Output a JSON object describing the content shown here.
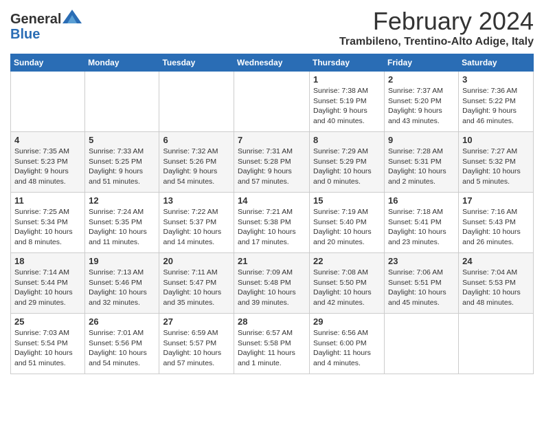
{
  "header": {
    "logo_line1": "General",
    "logo_line2": "Blue",
    "month_title": "February 2024",
    "subtitle": "Trambileno, Trentino-Alto Adige, Italy"
  },
  "days_of_week": [
    "Sunday",
    "Monday",
    "Tuesday",
    "Wednesday",
    "Thursday",
    "Friday",
    "Saturday"
  ],
  "weeks": [
    [
      {
        "day": "",
        "info": ""
      },
      {
        "day": "",
        "info": ""
      },
      {
        "day": "",
        "info": ""
      },
      {
        "day": "",
        "info": ""
      },
      {
        "day": "1",
        "info": "Sunrise: 7:38 AM\nSunset: 5:19 PM\nDaylight: 9 hours\nand 40 minutes."
      },
      {
        "day": "2",
        "info": "Sunrise: 7:37 AM\nSunset: 5:20 PM\nDaylight: 9 hours\nand 43 minutes."
      },
      {
        "day": "3",
        "info": "Sunrise: 7:36 AM\nSunset: 5:22 PM\nDaylight: 9 hours\nand 46 minutes."
      }
    ],
    [
      {
        "day": "4",
        "info": "Sunrise: 7:35 AM\nSunset: 5:23 PM\nDaylight: 9 hours\nand 48 minutes."
      },
      {
        "day": "5",
        "info": "Sunrise: 7:33 AM\nSunset: 5:25 PM\nDaylight: 9 hours\nand 51 minutes."
      },
      {
        "day": "6",
        "info": "Sunrise: 7:32 AM\nSunset: 5:26 PM\nDaylight: 9 hours\nand 54 minutes."
      },
      {
        "day": "7",
        "info": "Sunrise: 7:31 AM\nSunset: 5:28 PM\nDaylight: 9 hours\nand 57 minutes."
      },
      {
        "day": "8",
        "info": "Sunrise: 7:29 AM\nSunset: 5:29 PM\nDaylight: 10 hours\nand 0 minutes."
      },
      {
        "day": "9",
        "info": "Sunrise: 7:28 AM\nSunset: 5:31 PM\nDaylight: 10 hours\nand 2 minutes."
      },
      {
        "day": "10",
        "info": "Sunrise: 7:27 AM\nSunset: 5:32 PM\nDaylight: 10 hours\nand 5 minutes."
      }
    ],
    [
      {
        "day": "11",
        "info": "Sunrise: 7:25 AM\nSunset: 5:34 PM\nDaylight: 10 hours\nand 8 minutes."
      },
      {
        "day": "12",
        "info": "Sunrise: 7:24 AM\nSunset: 5:35 PM\nDaylight: 10 hours\nand 11 minutes."
      },
      {
        "day": "13",
        "info": "Sunrise: 7:22 AM\nSunset: 5:37 PM\nDaylight: 10 hours\nand 14 minutes."
      },
      {
        "day": "14",
        "info": "Sunrise: 7:21 AM\nSunset: 5:38 PM\nDaylight: 10 hours\nand 17 minutes."
      },
      {
        "day": "15",
        "info": "Sunrise: 7:19 AM\nSunset: 5:40 PM\nDaylight: 10 hours\nand 20 minutes."
      },
      {
        "day": "16",
        "info": "Sunrise: 7:18 AM\nSunset: 5:41 PM\nDaylight: 10 hours\nand 23 minutes."
      },
      {
        "day": "17",
        "info": "Sunrise: 7:16 AM\nSunset: 5:43 PM\nDaylight: 10 hours\nand 26 minutes."
      }
    ],
    [
      {
        "day": "18",
        "info": "Sunrise: 7:14 AM\nSunset: 5:44 PM\nDaylight: 10 hours\nand 29 minutes."
      },
      {
        "day": "19",
        "info": "Sunrise: 7:13 AM\nSunset: 5:46 PM\nDaylight: 10 hours\nand 32 minutes."
      },
      {
        "day": "20",
        "info": "Sunrise: 7:11 AM\nSunset: 5:47 PM\nDaylight: 10 hours\nand 35 minutes."
      },
      {
        "day": "21",
        "info": "Sunrise: 7:09 AM\nSunset: 5:48 PM\nDaylight: 10 hours\nand 39 minutes."
      },
      {
        "day": "22",
        "info": "Sunrise: 7:08 AM\nSunset: 5:50 PM\nDaylight: 10 hours\nand 42 minutes."
      },
      {
        "day": "23",
        "info": "Sunrise: 7:06 AM\nSunset: 5:51 PM\nDaylight: 10 hours\nand 45 minutes."
      },
      {
        "day": "24",
        "info": "Sunrise: 7:04 AM\nSunset: 5:53 PM\nDaylight: 10 hours\nand 48 minutes."
      }
    ],
    [
      {
        "day": "25",
        "info": "Sunrise: 7:03 AM\nSunset: 5:54 PM\nDaylight: 10 hours\nand 51 minutes."
      },
      {
        "day": "26",
        "info": "Sunrise: 7:01 AM\nSunset: 5:56 PM\nDaylight: 10 hours\nand 54 minutes."
      },
      {
        "day": "27",
        "info": "Sunrise: 6:59 AM\nSunset: 5:57 PM\nDaylight: 10 hours\nand 57 minutes."
      },
      {
        "day": "28",
        "info": "Sunrise: 6:57 AM\nSunset: 5:58 PM\nDaylight: 11 hours\nand 1 minute."
      },
      {
        "day": "29",
        "info": "Sunrise: 6:56 AM\nSunset: 6:00 PM\nDaylight: 11 hours\nand 4 minutes."
      },
      {
        "day": "",
        "info": ""
      },
      {
        "day": "",
        "info": ""
      }
    ]
  ]
}
